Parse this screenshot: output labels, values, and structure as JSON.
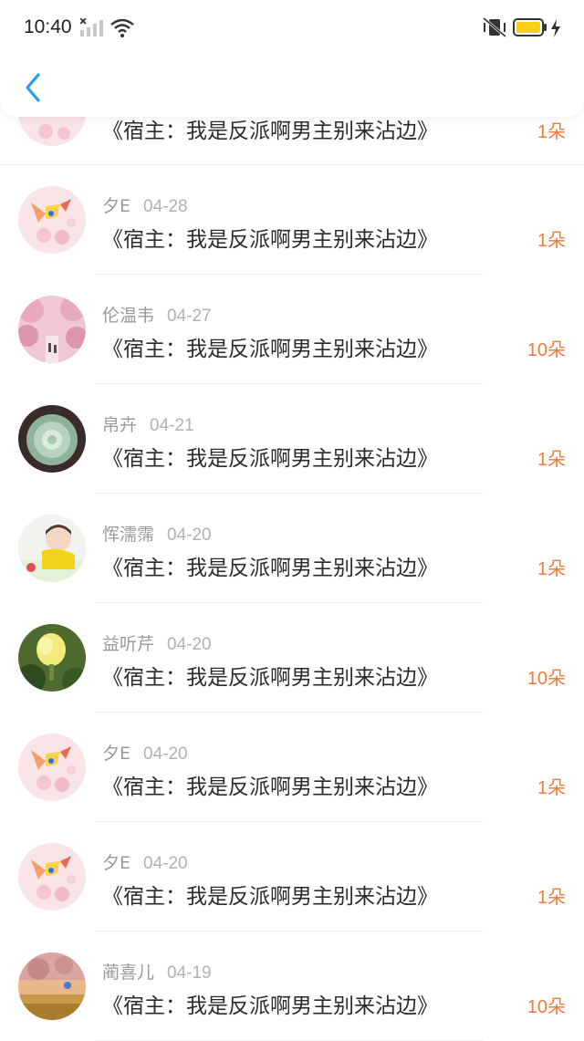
{
  "status_bar": {
    "time": "10:40",
    "icons": [
      "signal-off-icon",
      "wifi-icon",
      "mute-icon",
      "battery-icon",
      "charging-icon"
    ],
    "battery_color": "#f6cf1b"
  },
  "header": {
    "back_icon": "chevron-left-icon",
    "accent": "#2a9df4"
  },
  "list": {
    "accent_amount_color": "#f07a38",
    "items": [
      {
        "name": "",
        "date": "",
        "title": "《宿主：我是反派啊男主别来沾边》",
        "amount": "1朵",
        "avatar": "pink-fox-avatar"
      },
      {
        "name": "夕E",
        "date": "04-28",
        "title": "《宿主：我是反派啊男主别来沾边》",
        "amount": "1朵",
        "avatar": "pink-fox-avatar"
      },
      {
        "name": "伦温韦",
        "date": "04-27",
        "title": "《宿主：我是反派啊男主别来沾边》",
        "amount": "10朵",
        "avatar": "cherry-blossom-avatar"
      },
      {
        "name": "帛卉",
        "date": "04-21",
        "title": "《宿主：我是反派啊男主别来沾边》",
        "amount": "1朵",
        "avatar": "green-rose-avatar"
      },
      {
        "name": "恽濡霈",
        "date": "04-20",
        "title": "《宿主：我是反派啊男主别来沾边》",
        "amount": "1朵",
        "avatar": "boy-yellow-shirt-avatar"
      },
      {
        "name": "益听芹",
        "date": "04-20",
        "title": "《宿主：我是反派啊男主别来沾边》",
        "amount": "10朵",
        "avatar": "yellow-flower-avatar"
      },
      {
        "name": "夕E",
        "date": "04-20",
        "title": "《宿主：我是反派啊男主别来沾边》",
        "amount": "1朵",
        "avatar": "pink-fox-avatar"
      },
      {
        "name": "夕E",
        "date": "04-20",
        "title": "《宿主：我是反派啊男主别来沾边》",
        "amount": "1朵",
        "avatar": "pink-fox-avatar"
      },
      {
        "name": "蔺喜儿",
        "date": "04-19",
        "title": "《宿主：我是反派啊男主别来沾边》",
        "amount": "10朵",
        "avatar": "sunset-field-avatar"
      }
    ]
  }
}
